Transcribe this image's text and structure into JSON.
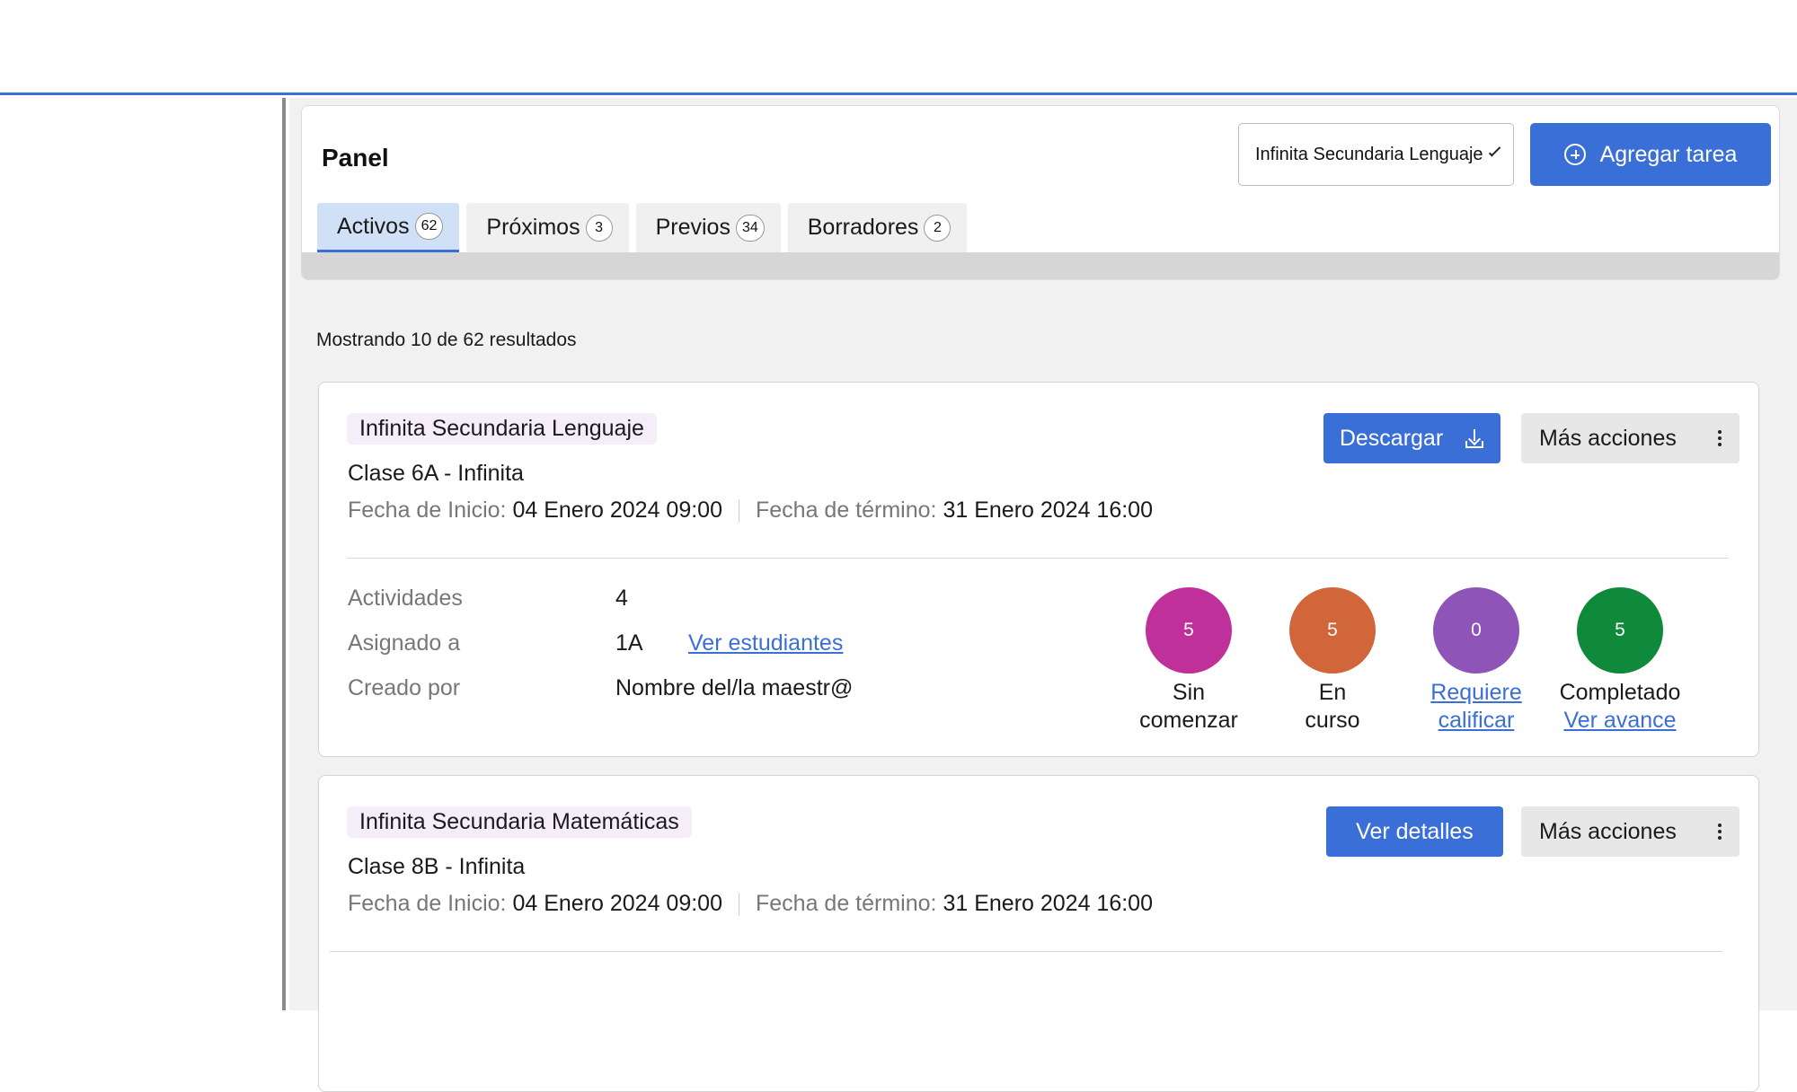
{
  "panel": {
    "title": "Panel",
    "subject_select": "Infinita Secundaria Lenguaje",
    "add_task_label": "Agregar tarea"
  },
  "tabs": [
    {
      "label": "Activos",
      "count": "62"
    },
    {
      "label": "Próximos",
      "count": "3"
    },
    {
      "label": "Previos",
      "count": "34"
    },
    {
      "label": "Borradores",
      "count": "2"
    }
  ],
  "results_text": "Mostrando 10 de 62 resultados",
  "labels": {
    "start_date": "Fecha de Inicio:",
    "end_date": "Fecha de término:",
    "activities": "Actividades",
    "assigned_to": "Asignado a",
    "created_by": "Creado por",
    "more_actions": "Más acciones"
  },
  "tasks": [
    {
      "subject": "Infinita Secundaria Lenguaje",
      "class_name": "Clase 6A - Infinita",
      "start_date": "04 Enero 2024 09:00",
      "end_date": "31 Enero 2024 16:00",
      "primary_action": "Descargar",
      "activities": "4",
      "assigned_to": "1A",
      "view_students": "Ver estudiantes",
      "created_by": "Nombre del/la maestr@",
      "stats": [
        {
          "count": "5",
          "line1": "Sin",
          "line2": "comenzar",
          "color": "#c0309b"
        },
        {
          "count": "5",
          "line1": "En",
          "line2": "curso",
          "color": "#d0663a"
        },
        {
          "count": "0",
          "line1": "Requiere",
          "line2": "calificar",
          "color": "#8e54b8"
        },
        {
          "count": "5",
          "line1": "Completado",
          "line2": "Ver avance",
          "color": "#0f8a3a"
        }
      ]
    },
    {
      "subject": "Infinita Secundaria Matemáticas",
      "class_name": "Clase 8B - Infinita",
      "start_date": "04 Enero 2024 09:00",
      "end_date": "31 Enero 2024 16:00",
      "primary_action": "Ver detalles"
    }
  ]
}
